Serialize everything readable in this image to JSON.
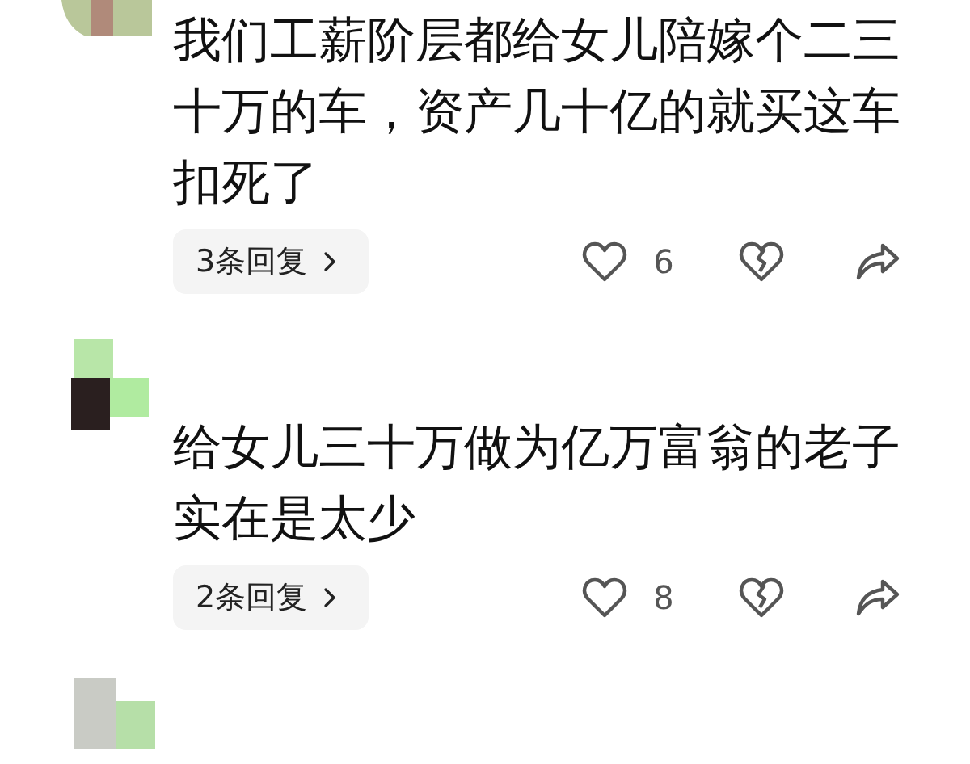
{
  "comments": [
    {
      "text": "我们工薪阶层都给女儿陪嫁个二三十万的车，资产几十亿的就买这车扣死了",
      "replies": "3条回复",
      "likes": "6"
    },
    {
      "text": "给女儿三十万做为亿万富翁的老子实在是太少",
      "replies": "2条回复",
      "likes": "8"
    }
  ]
}
